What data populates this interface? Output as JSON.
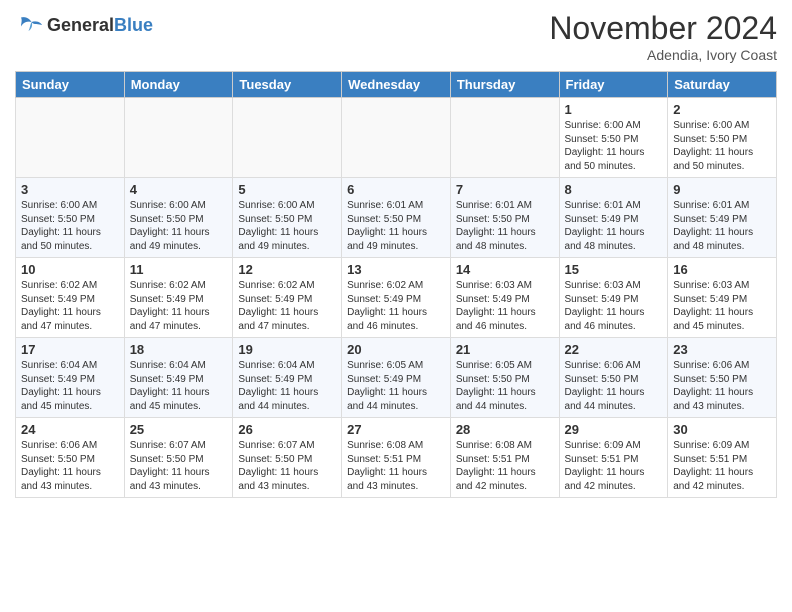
{
  "header": {
    "logo_general": "General",
    "logo_blue": "Blue",
    "month_title": "November 2024",
    "location": "Adendia, Ivory Coast"
  },
  "weekdays": [
    "Sunday",
    "Monday",
    "Tuesday",
    "Wednesday",
    "Thursday",
    "Friday",
    "Saturday"
  ],
  "weeks": [
    [
      {
        "day": "",
        "info": ""
      },
      {
        "day": "",
        "info": ""
      },
      {
        "day": "",
        "info": ""
      },
      {
        "day": "",
        "info": ""
      },
      {
        "day": "",
        "info": ""
      },
      {
        "day": "1",
        "info": "Sunrise: 6:00 AM\nSunset: 5:50 PM\nDaylight: 11 hours\nand 50 minutes."
      },
      {
        "day": "2",
        "info": "Sunrise: 6:00 AM\nSunset: 5:50 PM\nDaylight: 11 hours\nand 50 minutes."
      }
    ],
    [
      {
        "day": "3",
        "info": "Sunrise: 6:00 AM\nSunset: 5:50 PM\nDaylight: 11 hours\nand 50 minutes."
      },
      {
        "day": "4",
        "info": "Sunrise: 6:00 AM\nSunset: 5:50 PM\nDaylight: 11 hours\nand 49 minutes."
      },
      {
        "day": "5",
        "info": "Sunrise: 6:00 AM\nSunset: 5:50 PM\nDaylight: 11 hours\nand 49 minutes."
      },
      {
        "day": "6",
        "info": "Sunrise: 6:01 AM\nSunset: 5:50 PM\nDaylight: 11 hours\nand 49 minutes."
      },
      {
        "day": "7",
        "info": "Sunrise: 6:01 AM\nSunset: 5:50 PM\nDaylight: 11 hours\nand 48 minutes."
      },
      {
        "day": "8",
        "info": "Sunrise: 6:01 AM\nSunset: 5:49 PM\nDaylight: 11 hours\nand 48 minutes."
      },
      {
        "day": "9",
        "info": "Sunrise: 6:01 AM\nSunset: 5:49 PM\nDaylight: 11 hours\nand 48 minutes."
      }
    ],
    [
      {
        "day": "10",
        "info": "Sunrise: 6:02 AM\nSunset: 5:49 PM\nDaylight: 11 hours\nand 47 minutes."
      },
      {
        "day": "11",
        "info": "Sunrise: 6:02 AM\nSunset: 5:49 PM\nDaylight: 11 hours\nand 47 minutes."
      },
      {
        "day": "12",
        "info": "Sunrise: 6:02 AM\nSunset: 5:49 PM\nDaylight: 11 hours\nand 47 minutes."
      },
      {
        "day": "13",
        "info": "Sunrise: 6:02 AM\nSunset: 5:49 PM\nDaylight: 11 hours\nand 46 minutes."
      },
      {
        "day": "14",
        "info": "Sunrise: 6:03 AM\nSunset: 5:49 PM\nDaylight: 11 hours\nand 46 minutes."
      },
      {
        "day": "15",
        "info": "Sunrise: 6:03 AM\nSunset: 5:49 PM\nDaylight: 11 hours\nand 46 minutes."
      },
      {
        "day": "16",
        "info": "Sunrise: 6:03 AM\nSunset: 5:49 PM\nDaylight: 11 hours\nand 45 minutes."
      }
    ],
    [
      {
        "day": "17",
        "info": "Sunrise: 6:04 AM\nSunset: 5:49 PM\nDaylight: 11 hours\nand 45 minutes."
      },
      {
        "day": "18",
        "info": "Sunrise: 6:04 AM\nSunset: 5:49 PM\nDaylight: 11 hours\nand 45 minutes."
      },
      {
        "day": "19",
        "info": "Sunrise: 6:04 AM\nSunset: 5:49 PM\nDaylight: 11 hours\nand 44 minutes."
      },
      {
        "day": "20",
        "info": "Sunrise: 6:05 AM\nSunset: 5:49 PM\nDaylight: 11 hours\nand 44 minutes."
      },
      {
        "day": "21",
        "info": "Sunrise: 6:05 AM\nSunset: 5:50 PM\nDaylight: 11 hours\nand 44 minutes."
      },
      {
        "day": "22",
        "info": "Sunrise: 6:06 AM\nSunset: 5:50 PM\nDaylight: 11 hours\nand 44 minutes."
      },
      {
        "day": "23",
        "info": "Sunrise: 6:06 AM\nSunset: 5:50 PM\nDaylight: 11 hours\nand 43 minutes."
      }
    ],
    [
      {
        "day": "24",
        "info": "Sunrise: 6:06 AM\nSunset: 5:50 PM\nDaylight: 11 hours\nand 43 minutes."
      },
      {
        "day": "25",
        "info": "Sunrise: 6:07 AM\nSunset: 5:50 PM\nDaylight: 11 hours\nand 43 minutes."
      },
      {
        "day": "26",
        "info": "Sunrise: 6:07 AM\nSunset: 5:50 PM\nDaylight: 11 hours\nand 43 minutes."
      },
      {
        "day": "27",
        "info": "Sunrise: 6:08 AM\nSunset: 5:51 PM\nDaylight: 11 hours\nand 43 minutes."
      },
      {
        "day": "28",
        "info": "Sunrise: 6:08 AM\nSunset: 5:51 PM\nDaylight: 11 hours\nand 42 minutes."
      },
      {
        "day": "29",
        "info": "Sunrise: 6:09 AM\nSunset: 5:51 PM\nDaylight: 11 hours\nand 42 minutes."
      },
      {
        "day": "30",
        "info": "Sunrise: 6:09 AM\nSunset: 5:51 PM\nDaylight: 11 hours\nand 42 minutes."
      }
    ]
  ],
  "colors": {
    "header_bg": "#3a7fc1",
    "logo_blue": "#3a7fc1"
  }
}
